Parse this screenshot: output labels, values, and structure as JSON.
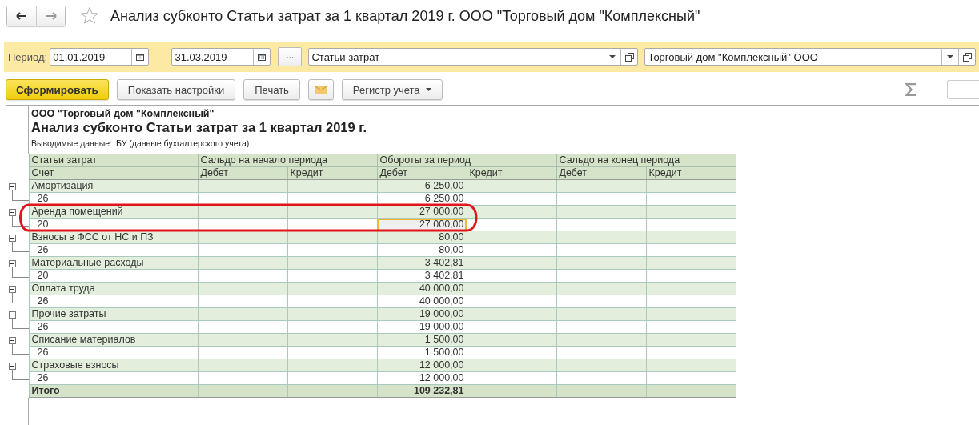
{
  "window": {
    "title": "Анализ субконто Статьи затрат за 1 квартал 2019 г. ООО \"Торговый дом \"Комплексный\""
  },
  "filters": {
    "period_label": "Период:",
    "date_from": "01.01.2019",
    "separator": "–",
    "date_to": "31.03.2019",
    "period_button": "...",
    "subconto": "Статьи затрат",
    "organization": "Торговый дом \"Комплексный\" ООО"
  },
  "toolbar": {
    "buttons": [
      {
        "kind": "primary",
        "label": "Сформировать"
      },
      {
        "kind": "plain",
        "label": "Показать настройки"
      },
      {
        "kind": "plain",
        "label": "Печать"
      },
      {
        "kind": "mail"
      },
      {
        "kind": "dropdown",
        "label": "Регистр учета"
      }
    ]
  },
  "report": {
    "organization": "ООО \"Торговый дом \"Комплексный\"",
    "title": "Анализ субконто Статьи затрат за 1 квартал 2019 г.",
    "output_label": "Выводимые данные:",
    "output_value": "БУ (данные бухгалтерского учета)",
    "header_groups": [
      "Статьи затрат",
      "Сальдо на начало периода",
      "Обороты за период",
      "Сальдо на конец периода"
    ],
    "subheaders": [
      "Счет",
      "Дебет",
      "Кредит",
      "Дебет",
      "Кредит",
      "Дебет",
      "Кредит"
    ],
    "groups": [
      {
        "name": "Амортизация",
        "turnover_debit": "6 250,00",
        "expanded": true,
        "children": [
          {
            "account": "26",
            "turnover_debit": "6 250,00",
            "selected": false
          }
        ]
      },
      {
        "name": "Аренда помещений",
        "turnover_debit": "27 000,00",
        "expanded": true,
        "children": [
          {
            "account": "20",
            "turnover_debit": "27 000,00",
            "selected": true
          }
        ]
      },
      {
        "name": "Взносы в ФСС от НС и ПЗ",
        "turnover_debit": "80,00",
        "expanded": true,
        "children": [
          {
            "account": "26",
            "turnover_debit": "80,00",
            "selected": false
          }
        ]
      },
      {
        "name": "Материальные расходы",
        "turnover_debit": "3 402,81",
        "expanded": true,
        "children": [
          {
            "account": "20",
            "turnover_debit": "3 402,81",
            "selected": false
          }
        ]
      },
      {
        "name": "Оплата труда",
        "turnover_debit": "40 000,00",
        "expanded": true,
        "children": [
          {
            "account": "26",
            "turnover_debit": "40 000,00",
            "selected": false
          }
        ]
      },
      {
        "name": "Прочие затраты",
        "turnover_debit": "19 000,00",
        "expanded": true,
        "children": [
          {
            "account": "26",
            "turnover_debit": "19 000,00",
            "selected": false
          }
        ]
      },
      {
        "name": "Списание материалов",
        "turnover_debit": "1 500,00",
        "expanded": true,
        "children": [
          {
            "account": "26",
            "turnover_debit": "1 500,00",
            "selected": false
          }
        ]
      },
      {
        "name": "Страховые взносы",
        "turnover_debit": "12 000,00",
        "expanded": true,
        "children": [
          {
            "account": "26",
            "turnover_debit": "12 000,00",
            "selected": false
          }
        ]
      }
    ],
    "total": {
      "label": "Итого",
      "turnover_debit": "109 232,81"
    }
  }
}
